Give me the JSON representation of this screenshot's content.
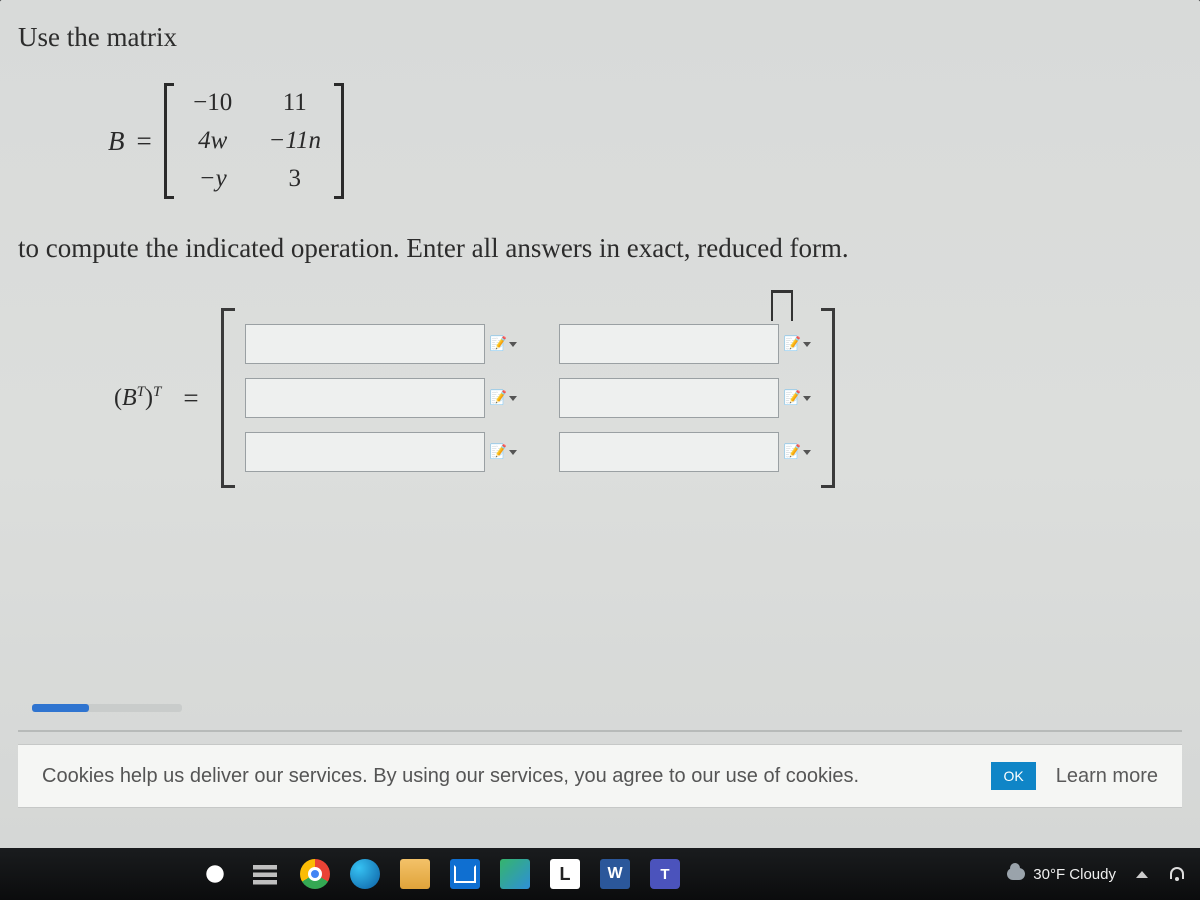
{
  "problem": {
    "line1": "Use the matrix",
    "matrix_name": "B",
    "equals": "=",
    "rows": [
      [
        "−10",
        "11"
      ],
      [
        "4w",
        "−11n"
      ],
      [
        "−y",
        "3"
      ]
    ],
    "line2": "to compute the indicated operation. Enter all answers in exact, reduced form.",
    "answer_label_html": "(Bᵀ)ᵀ",
    "cursor_hint": "I"
  },
  "answer_inputs": {
    "col1": [
      "",
      "",
      ""
    ],
    "col2": [
      "",
      "",
      ""
    ]
  },
  "cookies": {
    "message": "Cookies help us deliver our services. By using our services, you agree to our use of cookies.",
    "ok": "OK",
    "learn": "Learn more"
  },
  "taskbar": {
    "weather": "30°F Cloudy"
  }
}
